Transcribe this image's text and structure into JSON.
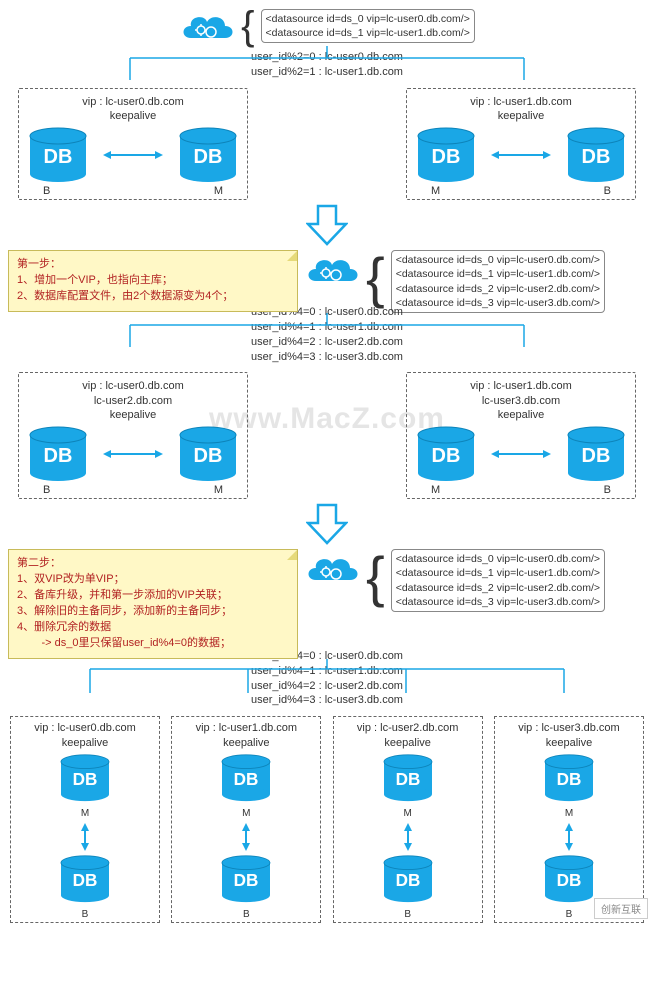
{
  "stage1": {
    "datasources": [
      "<datasource id=ds_0 vip=lc-user0.db.com/>",
      "<datasource id=ds_1 vip=lc-user1.db.com/>"
    ],
    "rules": [
      "user_id%2=0 : lc-user0.db.com",
      "user_id%2=1 : lc-user1.db.com"
    ],
    "clusterA": {
      "vip": "vip : lc-user0.db.com",
      "keepalive": "keepalive",
      "left": "B",
      "right": "M"
    },
    "clusterB": {
      "vip": "vip : lc-user1.db.com",
      "keepalive": "keepalive",
      "left": "M",
      "right": "B"
    }
  },
  "step1": {
    "title": "第一步：",
    "lines": [
      "1、增加一个VIP，也指向主库；",
      "2、数据库配置文件，由2个数据源变为4个；"
    ]
  },
  "stage2": {
    "datasources": [
      "<datasource id=ds_0 vip=lc-user0.db.com/>",
      "<datasource id=ds_1 vip=lc-user1.db.com/>",
      "<datasource id=ds_2 vip=lc-user2.db.com/>",
      "<datasource id=ds_3 vip=lc-user3.db.com/>"
    ],
    "rules": [
      "user_id%4=0 : lc-user0.db.com",
      "user_id%4=1 : lc-user1.db.com",
      "user_id%4=2 : lc-user2.db.com",
      "user_id%4=3 : lc-user3.db.com"
    ],
    "clusterA": {
      "vip1": "vip : lc-user0.db.com",
      "vip2": "lc-user2.db.com",
      "keepalive": "keepalive",
      "left": "B",
      "right": "M"
    },
    "clusterB": {
      "vip1": "vip : lc-user1.db.com",
      "vip2": "lc-user3.db.com",
      "keepalive": "keepalive",
      "left": "M",
      "right": "B"
    }
  },
  "step2": {
    "title": "第二步：",
    "lines": [
      "1、双VIP改为单VIP；",
      "2、备库升级，并和第一步添加的VIP关联；",
      "3、解除旧的主备同步，添加新的主备同步；",
      "4、删除冗余的数据",
      "        -> ds_0里只保留user_id%4=0的数据；"
    ]
  },
  "stage3": {
    "datasources": [
      "<datasource id=ds_0 vip=lc-user0.db.com/>",
      "<datasource id=ds_1 vip=lc-user1.db.com/>",
      "<datasource id=ds_2 vip=lc-user2.db.com/>",
      "<datasource id=ds_3 vip=lc-user3.db.com/>"
    ],
    "rules": [
      "user_id%4=0 : lc-user0.db.com",
      "user_id%4=1 : lc-user1.db.com",
      "user_id%4=2 : lc-user2.db.com",
      "user_id%4=3 : lc-user3.db.com"
    ],
    "clusters": [
      {
        "vip": "vip : lc-user0.db.com",
        "keepalive": "keepalive",
        "top": "M",
        "bottom": "B"
      },
      {
        "vip": "vip : lc-user1.db.com",
        "keepalive": "keepalive",
        "top": "M",
        "bottom": "B"
      },
      {
        "vip": "vip : lc-user2.db.com",
        "keepalive": "keepalive",
        "top": "M",
        "bottom": "B"
      },
      {
        "vip": "vip : lc-user3.db.com",
        "keepalive": "keepalive",
        "top": "M",
        "bottom": "B"
      }
    ]
  },
  "db_text": "DB",
  "watermark": "www.MacZ.com",
  "corner": "创新互联"
}
